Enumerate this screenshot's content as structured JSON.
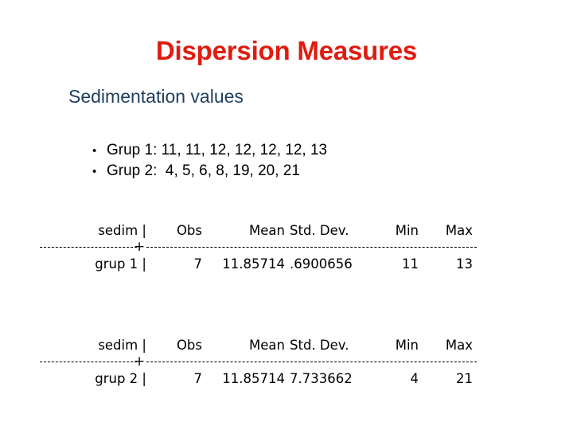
{
  "slide": {
    "title": "Dispersion Measures",
    "subtitle": "Sedimentation values",
    "title_color": "#E01B10",
    "subtitle_color": "#1F4061",
    "background_color": "#FFFFFF"
  },
  "bullets": [
    {
      "marker": "•",
      "text": "Grup 1: 11, 11, 12, 12, 12, 12, 13"
    },
    {
      "marker": "•",
      "text": "Grup 2:  4, 5, 6, 8, 19, 20, 21"
    }
  ],
  "tables": [
    {
      "headers": {
        "variable": "sedim |",
        "obs": "Obs",
        "mean": "Mean",
        "std_dev": "Std. Dev.",
        "min": "Min",
        "max": "Max"
      },
      "separator": "------------+----------------------------------------",
      "separator_junction": "+",
      "row": {
        "variable": "grup 1 |",
        "obs": "7",
        "mean": "11.85714",
        "std_dev": ".6900656",
        "min": "11",
        "max": "13"
      }
    },
    {
      "headers": {
        "variable": "sedim |",
        "obs": "Obs",
        "mean": "Mean",
        "std_dev": "Std. Dev.",
        "min": "Min",
        "max": "Max"
      },
      "separator": "------------+----------------------------------------",
      "separator_junction": "+",
      "row": {
        "variable": "grup 2 |",
        "obs": "7",
        "mean": "11.85714",
        "std_dev": "7.733662",
        "min": "4",
        "max": "21"
      }
    }
  ]
}
